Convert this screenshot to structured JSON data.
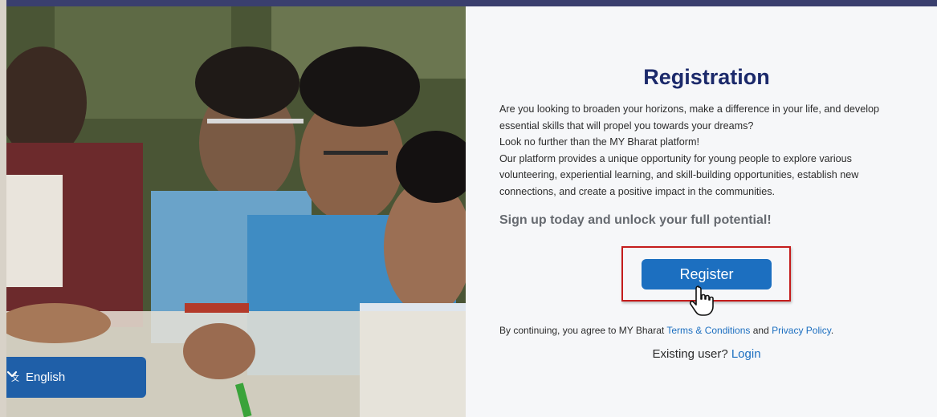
{
  "language_selector": {
    "label": "English",
    "icon": "translate-icon",
    "chevron": "chevron-down-icon"
  },
  "registration": {
    "title": "Registration",
    "paragraph_lines": [
      "Are you looking to broaden your horizons, make a difference in your life, and develop",
      "essential skills that will propel you towards your dreams?",
      "Look no further than the MY Bharat platform!",
      "Our platform provides a unique opportunity for young people to explore various",
      "volunteering, experiential learning, and skill-building opportunities, establish new",
      "connections, and create a positive impact in the communities."
    ],
    "signup_text": "Sign up today and unlock your full potential!",
    "register_label": "Register",
    "terms_prefix": "By continuing, you agree to MY Bharat ",
    "terms_link": "Terms & Conditions",
    "terms_and": " and ",
    "privacy_link": "Privacy Policy",
    "terms_suffix": ".",
    "existing_prefix": "Existing user? ",
    "login_link": "Login"
  },
  "colors": {
    "title": "#1c2a6b",
    "button": "#1c6fc0",
    "highlight_border": "#c41c1c",
    "language_selector_bg": "#1f5fa8",
    "link": "#1c6fc0"
  }
}
